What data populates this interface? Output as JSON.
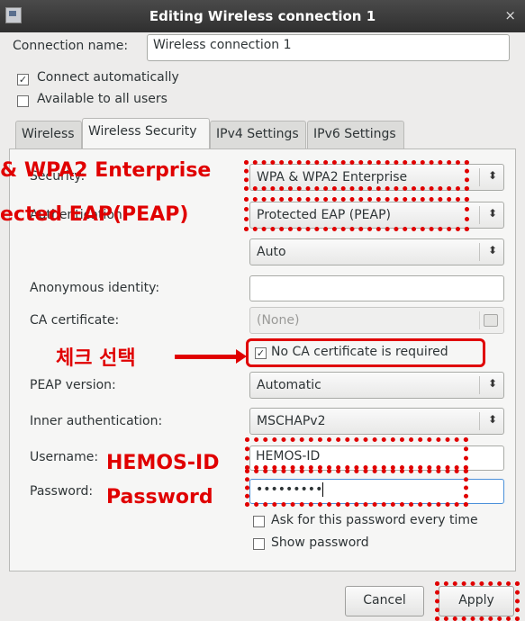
{
  "window": {
    "title": "Editing Wireless connection 1",
    "close_glyph": "×"
  },
  "general": {
    "connection_name_label": "Connection name:",
    "connection_name_value": "Wireless connection 1",
    "connect_auto_label": "Connect automatically",
    "connect_auto_checked": true,
    "all_users_label": "Available to all users",
    "all_users_checked": false
  },
  "tabs": [
    {
      "label": "Wireless",
      "active": false
    },
    {
      "label": "Wireless Security",
      "active": true
    },
    {
      "label": "IPv4 Settings",
      "active": false
    },
    {
      "label": "IPv6 Settings",
      "active": false
    }
  ],
  "security": {
    "security_label": "Security:",
    "security_value": "WPA & WPA2 Enterprise",
    "authentication_label": "Authentication:",
    "authentication_value": "Protected EAP (PEAP)",
    "auto_value": "Auto",
    "anon_identity_label": "Anonymous identity:",
    "anon_identity_value": "",
    "ca_cert_label": "CA certificate:",
    "ca_cert_value": "(None)",
    "no_ca_label": "No CA certificate is required",
    "no_ca_checked": true,
    "peap_version_label": "PEAP version:",
    "peap_version_value": "Automatic",
    "inner_auth_label": "Inner authentication:",
    "inner_auth_value": "MSCHAPv2",
    "username_label": "Username:",
    "username_value": "HEMOS-ID",
    "password_label": "Password:",
    "password_value": "•••••••••",
    "ask_password_label": "Ask for this password every time",
    "show_password_label": "Show password"
  },
  "buttons": {
    "cancel": "Cancel",
    "apply": "Apply"
  },
  "annotations": {
    "security_overlay": "& WPA2 Enterprise",
    "auth_overlay": "ected EAP(PEAP)",
    "check_note": "체크 선택",
    "username_note": "HEMOS-ID",
    "password_note": "Password",
    "annotation_color": "#e00000"
  }
}
